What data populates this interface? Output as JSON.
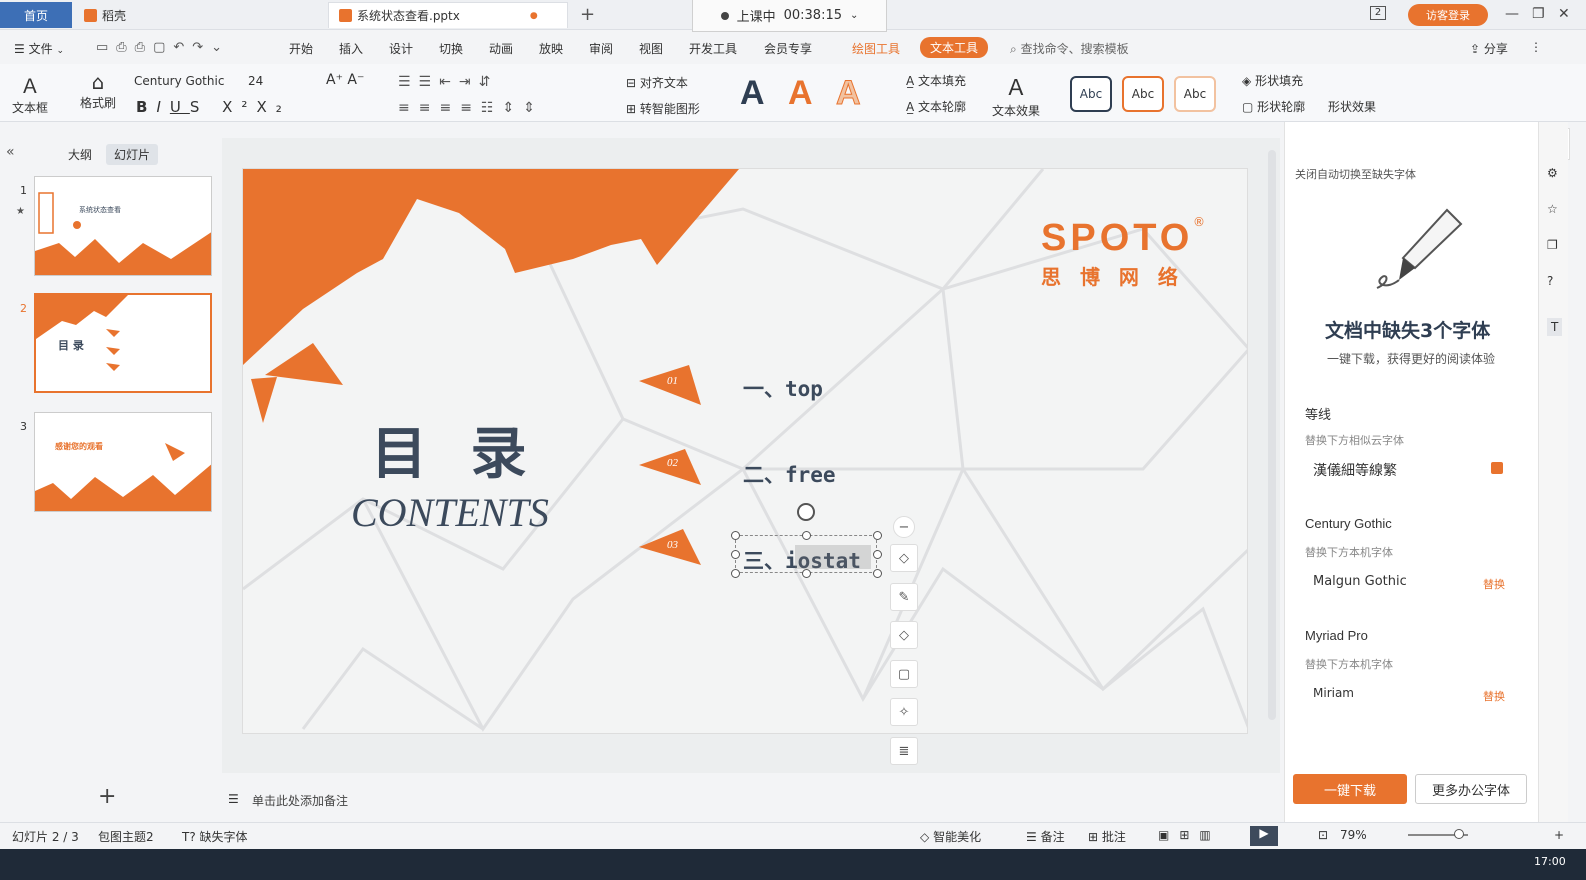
{
  "tabs": {
    "home": "首页",
    "daoke": "稻壳",
    "doc": "系统状态查看.pptx"
  },
  "recording": {
    "status": "上课中",
    "time": "00:38:15"
  },
  "window": {
    "page_badge": "2",
    "login": "访客登录"
  },
  "menu": {
    "file": "文件",
    "items": [
      "开始",
      "插入",
      "设计",
      "切换",
      "动画",
      "放映",
      "审阅",
      "视图",
      "开发工具",
      "会员专享"
    ],
    "draw_tools": "绘图工具",
    "text_tools": "文本工具",
    "search": "查找命令、搜索模板",
    "share": "分享"
  },
  "ribbon": {
    "textbox": "文本框",
    "format_painter": "格式刷",
    "font": "Century Gothic",
    "size": "24",
    "align_text": "对齐文本",
    "smart_shape": "转智能图形",
    "text_fill": "文本填充",
    "text_outline": "文本轮廓",
    "text_effect": "文本效果",
    "shape_fill": "形状填充",
    "shape_outline": "形状轮廓",
    "shape_effect": "形状效果",
    "abc": "Abc",
    "a_letter": "A"
  },
  "left_panel": {
    "tab_outline": "大纲",
    "tab_slides": "幻灯片",
    "slides": [
      {
        "num": "1",
        "title": "系统状态查看"
      },
      {
        "num": "2",
        "title": "目 录"
      },
      {
        "num": "3",
        "title": "感谢您的观看"
      }
    ],
    "add": "+"
  },
  "slide": {
    "brand": "SPOTO",
    "brand_cn": "思 博 网 络",
    "title": "目 录",
    "subtitle": "CONTENTS",
    "items": [
      {
        "num": "01",
        "text": "一、top"
      },
      {
        "num": "02",
        "text": "二、free"
      },
      {
        "num": "03",
        "text": "三、iostat"
      }
    ]
  },
  "notes": {
    "placeholder": "单击此处添加备注"
  },
  "right_panel": {
    "auto_switch": "关闭自动切换至缺失字体",
    "title": "文档中缺失3个字体",
    "subtitle": "一键下载，获得更好的阅读体验",
    "fonts": [
      {
        "name": "等线",
        "hint": "替换下方相似云字体",
        "replacement": "漢儀細等線繁",
        "action": ""
      },
      {
        "name": "Century Gothic",
        "hint": "替换下方本机字体",
        "replacement": "Malgun Gothic",
        "action": "替换"
      },
      {
        "name": "Myriad Pro",
        "hint": "替换下方本机字体",
        "replacement": "Miriam",
        "action": "替换"
      }
    ],
    "download": "一键下载",
    "more_fonts": "更多办公字体",
    "cloud_label": "云"
  },
  "status": {
    "slide": "幻灯片 2 / 3",
    "theme": "包图主题2",
    "missing": "缺失字体",
    "beautify": "智能美化",
    "notes": "备注",
    "comments": "批注",
    "zoom": "79%"
  },
  "taskbar": {
    "time": "17:00"
  },
  "colors": {
    "accent": "#e8732e",
    "text_dark": "#3c4a5c",
    "tab_blue": "#3d6fb6"
  }
}
